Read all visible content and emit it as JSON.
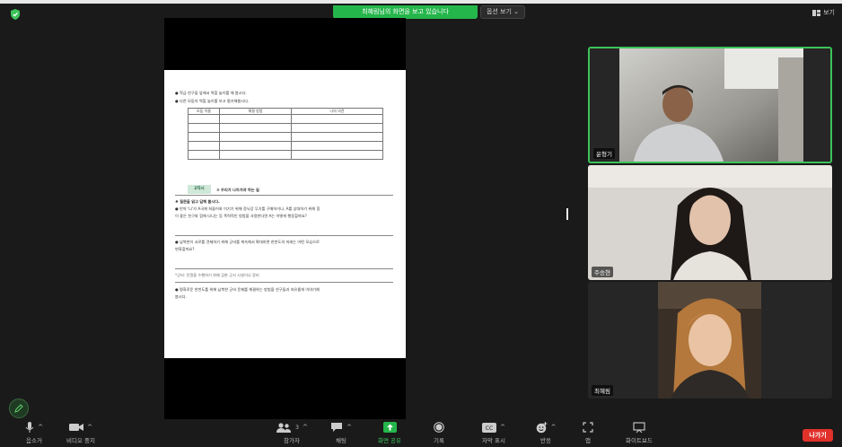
{
  "header": {
    "share_banner": "최혜림님의 화면을 보고 있습니다",
    "view_options": "옵션 보기",
    "view_label": "보기"
  },
  "document": {
    "bullet1": "● 학급 친구들 앞에서 역할 놀이를 해 봅시다.",
    "bullet2": "● 다른 모둠의 역할 놀이를 보고 평가해봅시다.",
    "table_headers": [
      "모둠 이름",
      "해결 방법",
      "나의 의견"
    ],
    "lesson_tag": "2차시",
    "lesson_title": "③ 우리가 나아가야 하는 길",
    "section_heading": "♣ 질문을 읽고 답해 봅시다.",
    "q1_line1": "● 만약 '나'가 A국에 쳐들어와 이기기 위해 정닉강 무기를 구매하거나, A를 상대하기 위해 힘",
    "q1_line2": "이 좋은 친구와 힘께 다니는 등 폭력적인 방법을 사용한다면 A는 어떻게 행동할까요?",
    "q2_line1": "● 남북한이 서로를 견제하기 위해 군비를 계속해서 확대하면 한반도의 미래는 어떤 모습으로",
    "q2_line2": "변화할까요?",
    "note": "*군비: 전쟁을 수행하기 위해 갖춘 군사 시설이나 장비",
    "q3_line1": "● 평화로운 한반도를 위해 남북한 군비 문제를 해결하는 방법을 친구들과 자유롭게 이야기해",
    "q3_line2": "봅시다."
  },
  "participants": [
    {
      "name": "윤형기"
    },
    {
      "name": "주승현"
    },
    {
      "name": "최혜림"
    }
  ],
  "toolbar": {
    "mute": "음소거",
    "video": "비디오 중지",
    "participants": "참가자",
    "participants_count": "3",
    "chat": "채팅",
    "share": "화면 공유",
    "record": "기록",
    "captions": "자막 표시",
    "reactions": "반응",
    "apps": "앱",
    "whiteboard": "화이트보드",
    "leave": "나가기"
  },
  "colors": {
    "accent_green": "#25b64b",
    "leave_red": "#e0312b",
    "background": "#1a1a1a"
  }
}
